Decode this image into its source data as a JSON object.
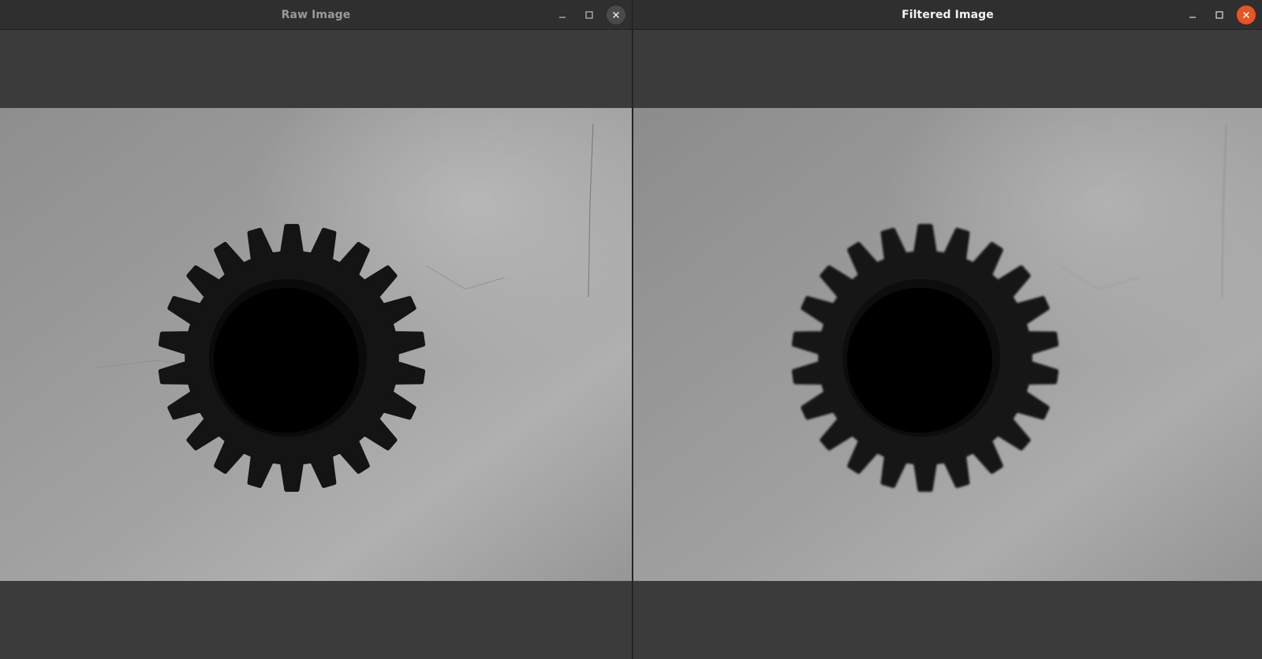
{
  "windows": [
    {
      "title": "Raw Image",
      "state": "inactive",
      "controls": {
        "minimize_icon": "minimize-icon",
        "maximize_icon": "maximize-icon",
        "close_icon": "close-icon"
      }
    },
    {
      "title": "Filtered Image",
      "state": "active",
      "controls": {
        "minimize_icon": "minimize-icon",
        "maximize_icon": "maximize-icon",
        "close_icon": "close-icon"
      }
    }
  ],
  "image_content": {
    "subject": "spur-gear",
    "gear_teeth": 22
  },
  "colors": {
    "titlebar": "#2f2f2f",
    "window_background": "#3b3b3b",
    "close_active": "#e95420",
    "close_inactive": "#4a4a4a",
    "gear": "#141414",
    "gear_bore": "#000000",
    "background_paper": "#9a9a9a"
  }
}
